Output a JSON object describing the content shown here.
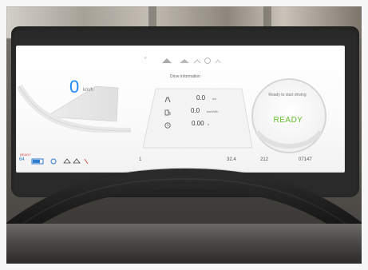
{
  "screen": {
    "speed": "0",
    "speed_unit": "km/h",
    "top_icon_left": "P",
    "panel_title": "Drive information",
    "metrics": [
      {
        "icon": "road-icon",
        "value": "0.0",
        "unit": "km"
      },
      {
        "icon": "fuel-efficiency-icon",
        "value": "0.0",
        "unit": "km/kWh"
      },
      {
        "icon": "clock-icon",
        "value": "0.00",
        "unit": "h"
      }
    ],
    "ready_message": "Ready to start driving",
    "ready_label": "READY",
    "status_bar": {
      "left_label": "READY",
      "left_value": "64",
      "mid_value": "1",
      "odometer_a": "32.4",
      "range_value": "212",
      "odometer_b": "07147"
    }
  },
  "colors": {
    "speed": "#1e88ff",
    "ready": "#63c12e",
    "status_bar_text": "#2e7dd1",
    "status_bar_alert": "#e03a3a"
  },
  "icons": {
    "warning": "warning-icon",
    "car": "car-icon",
    "gauge": "gauge-icon",
    "steering": "steering-wheel"
  }
}
